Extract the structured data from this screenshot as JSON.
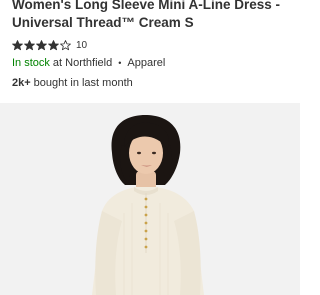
{
  "product": {
    "title_line1": "Women's Long Sleeve Mini A-Line Dress -",
    "title_line2": "Universal Thread™ Cream S",
    "rating": {
      "value": 4,
      "max": 5,
      "count": "10"
    },
    "stock_status": "In stock",
    "store_text": "at Northfield",
    "separator": "•",
    "category": "Apparel",
    "bought_count": "2k+",
    "bought_text": "bought in last month"
  },
  "colors": {
    "in_stock": "#008300",
    "star": "#333333",
    "image_bg": "#f2f2f2",
    "dress": "#f1ebdd"
  },
  "icons": {
    "star_filled": "star-filled-icon",
    "star_empty": "star-empty-icon"
  }
}
